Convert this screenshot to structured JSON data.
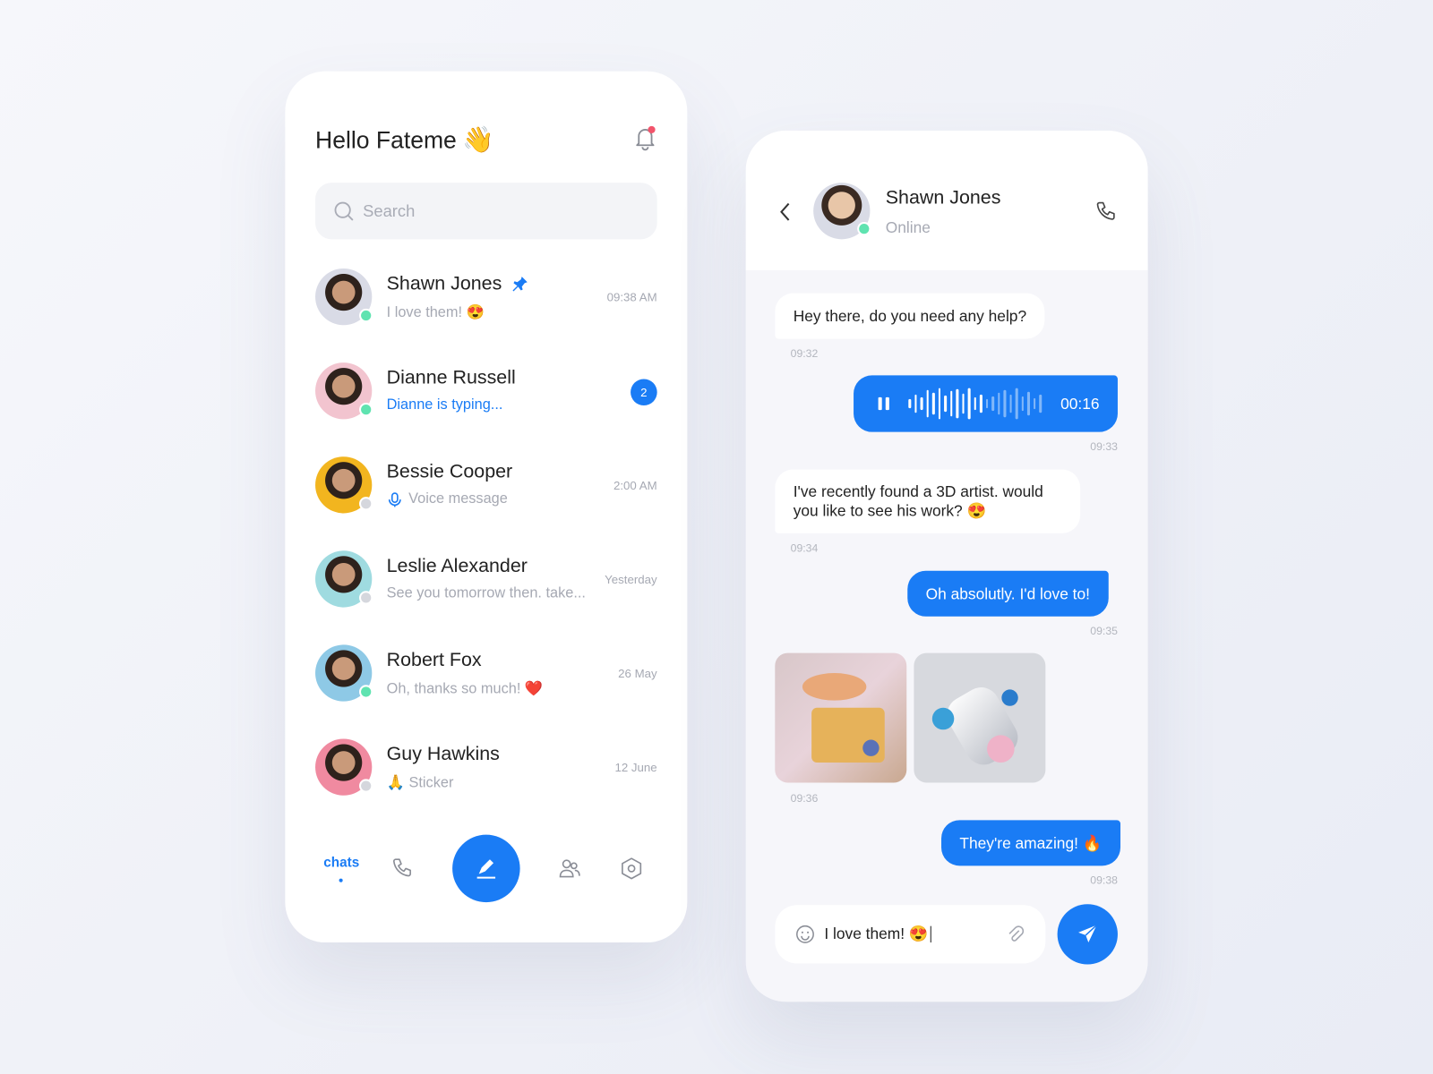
{
  "list_screen": {
    "greeting": "Hello Fateme",
    "greeting_emoji": "👋",
    "search_placeholder": "Search",
    "chats": [
      {
        "name": "Shawn Jones",
        "preview": "I love them! 😍",
        "time": "09:38 AM",
        "pinned": true,
        "online": true,
        "avatar_color": "#d9dbe6"
      },
      {
        "name": "Dianne Russell",
        "preview": "Dianne is typing...",
        "unread": "2",
        "online": true,
        "typing": true,
        "avatar_color": "#f2c4cf"
      },
      {
        "name": "Bessie Cooper",
        "preview": "Voice message",
        "time": "2:00 AM",
        "online": false,
        "avatar_color": "#f2b51f"
      },
      {
        "name": "Leslie Alexander",
        "preview": "See you tomorrow then. take...",
        "time": "Yesterday",
        "online": false,
        "avatar_color": "#9fdbe0"
      },
      {
        "name": "Robert Fox",
        "preview": "Oh, thanks so much! ❤️",
        "time": "26 May",
        "online": true,
        "avatar_color": "#8ec9e6"
      },
      {
        "name": "Guy Hawkins",
        "preview": "🙏 Sticker",
        "time": "12 June",
        "online": false,
        "avatar_color": "#f08aa0"
      }
    ],
    "nav": {
      "chats": "chats"
    }
  },
  "chat_screen": {
    "contact_name": "Shawn Jones",
    "status": "Online",
    "messages": [
      {
        "text": "Hey there, do you need any help?",
        "time": "09:32"
      },
      {
        "voice_duration": "00:16",
        "time": "09:33",
        "played_fraction": 0.45
      },
      {
        "text": "I've recently found a 3D artist. would you like to see his work? 😍",
        "time": "09:34"
      },
      {
        "text": "Oh absolutly. I'd love to!",
        "time": "09:35"
      },
      {
        "time": "09:36"
      },
      {
        "text": "They're amazing! 🔥",
        "time": "09:38"
      }
    ],
    "composer_value": "I love them! 😍"
  },
  "colors": {
    "accent": "#1a7cf5",
    "online": "#5fe3b0",
    "offline": "#d5d7dd"
  }
}
